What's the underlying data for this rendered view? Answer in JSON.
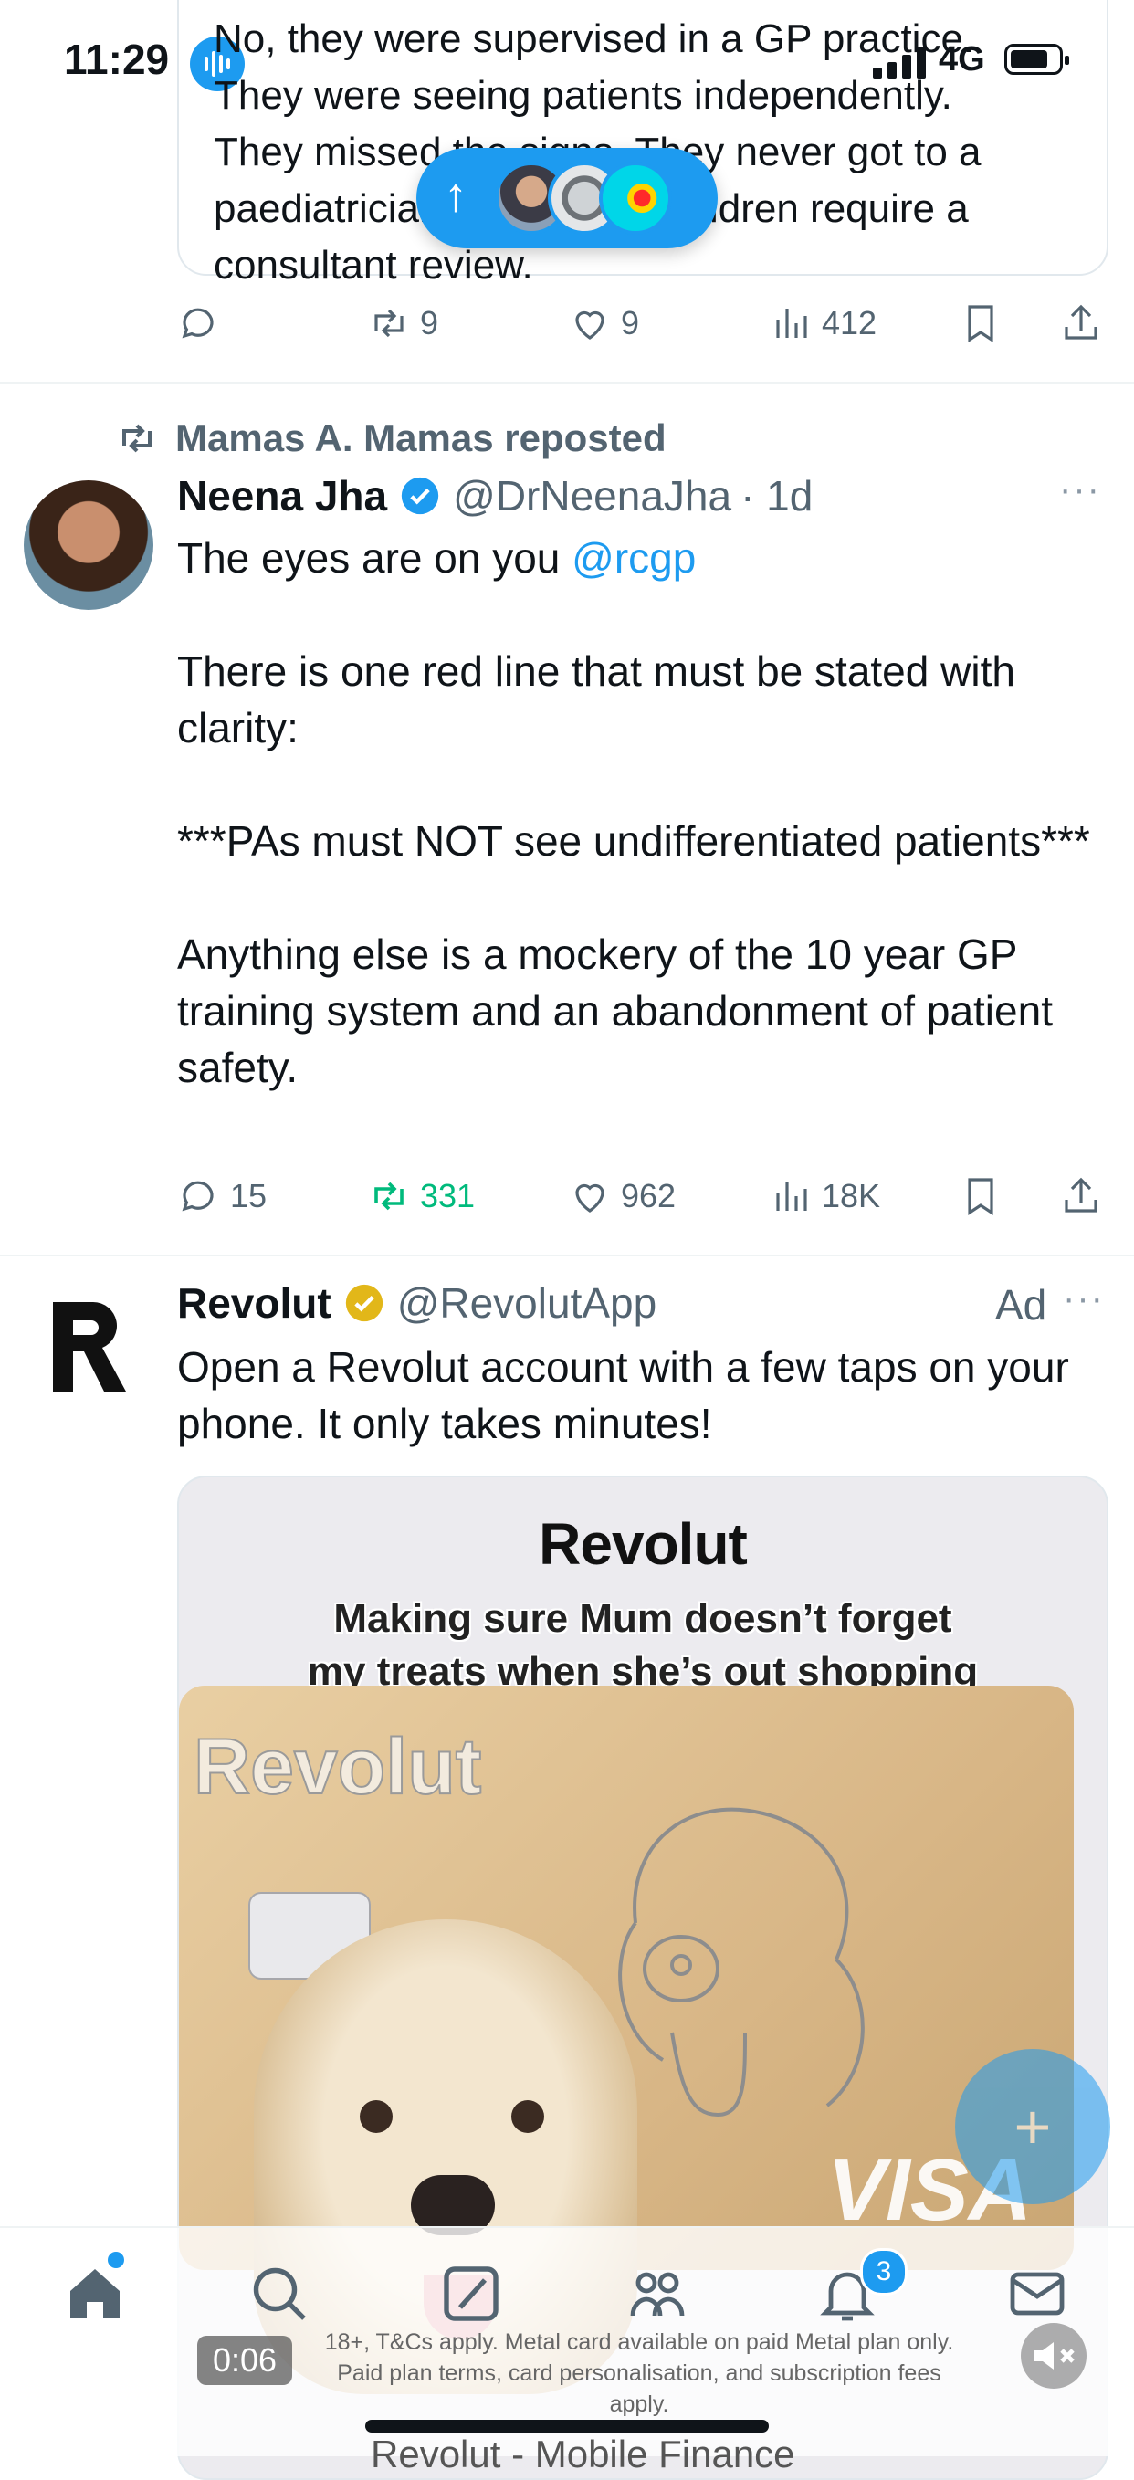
{
  "status_bar": {
    "time": "11:29",
    "network": "4G"
  },
  "quoted_tweet": {
    "text": "No, they were supervised in a GP practice.\nThey were seeing patients independently.\nThey missed the signs. They never got to a\npaediatrician. In hospital children require a\nconsultant review.",
    "actions": {
      "reply": "",
      "repost": "9",
      "like": "9",
      "views": "412"
    }
  },
  "new_posts_pill": {
    "arrow": "↑"
  },
  "repost": {
    "reposted_by": "Mamas A. Mamas reposted",
    "author_name": "Neena Jha",
    "author_handle": "@DrNeenaJha",
    "time": "· 1d",
    "more": "···",
    "text_prefix": "The eyes are on you ",
    "mention": "@rcgp",
    "text_body": "\n\nThere is one red line that must be stated with clarity:\n\n***PAs must NOT see undifferentiated patients***\n\nAnything else is a mockery of the 10 year GP training system and an abandonment of patient safety.",
    "actions": {
      "reply": "15",
      "repost": "331",
      "like": "962",
      "views": "18K"
    }
  },
  "ad": {
    "author_name": "Revolut",
    "author_handle": "@RevolutApp",
    "label": "Ad",
    "more": "···",
    "text": "Open a Revolut account with a few taps on your phone. It only takes minutes!",
    "media_brand": "Revolut",
    "media_caption": "Making sure Mum doesn’t forget\nmy treats when she’s out shopping",
    "card_word": "Revolut",
    "card_network": "VISA",
    "timer": "0:06",
    "disclaimer": "18+, T&Cs apply. Metal card available on paid Metal plan only.\nPaid plan terms, card personalisation, and subscription fees apply.",
    "next_label": "Revolut - Mobile Finance"
  },
  "fab": {
    "label": "+"
  },
  "nav": {
    "notifications_badge": "3"
  },
  "colors": {
    "accent": "#1d9bf0",
    "repost_green": "#00ba7c",
    "muted": "#536471"
  }
}
